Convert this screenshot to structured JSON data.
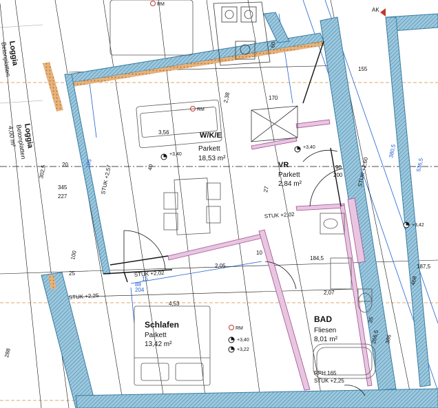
{
  "rooms": {
    "wke": {
      "name": "W/K/E",
      "finish": "Parkett",
      "area": "18,53 m²"
    },
    "vr": {
      "name": "VR",
      "finish": "Parkett",
      "area": "2,84 m²"
    },
    "schlafen": {
      "name": "Schlafen",
      "finish": "Parkett",
      "area": "13,42 m²"
    },
    "bad": {
      "name": "BAD",
      "finish": "Fliesen",
      "area": "8,01 m²"
    },
    "loggia1": {
      "name": "Loggia",
      "finish": "Betonplatten"
    },
    "loggia2": {
      "name": "Loggia",
      "finish": "Betonplatten",
      "area": "4,00 m²"
    }
  },
  "rm_labels": [
    "RM",
    "RM",
    "RM"
  ],
  "levels": [
    "+3,40",
    "+3,40",
    "+3,40",
    "+3,42",
    "+3,22"
  ],
  "stuk": [
    "STUK +2,25",
    "STUK +2,02",
    "STUK +2,02",
    "STUK +2,60",
    "STUK +2,25",
    "STUK +2,57"
  ],
  "rph": "RPH 165",
  "ak": "AK",
  "dims": {
    "d356": "3,56",
    "d453": "4,53",
    "d205": "2,05",
    "d207": "2,07",
    "d345": "345",
    "d227": "227",
    "d3025": "302,5",
    "d170": "170",
    "d155": "155",
    "d238": "2,38",
    "d1845": "184,5",
    "d88": "88",
    "d15": "15",
    "d204": "204",
    "d200": "200",
    "d90": "90",
    "d100": "100",
    "d60": "60",
    "d20": "20",
    "d10": "10",
    "d40": "40",
    "d468": "468",
    "d288": "288",
    "d386": "386",
    "d2665": "266,5",
    "d1875": "187,5",
    "d3805": "380,5",
    "d5365": "536,5",
    "d27": "27",
    "d25": "25",
    "d35": "35",
    "d195": "195"
  },
  "colors": {
    "wall": "#7fb8d4",
    "wall_hatch": "#3a7ca0",
    "insulation": "#d9a066",
    "partition": "#c77dba",
    "dim_blue": "#1f5fd0",
    "orange_axis": "#d98a3a"
  }
}
